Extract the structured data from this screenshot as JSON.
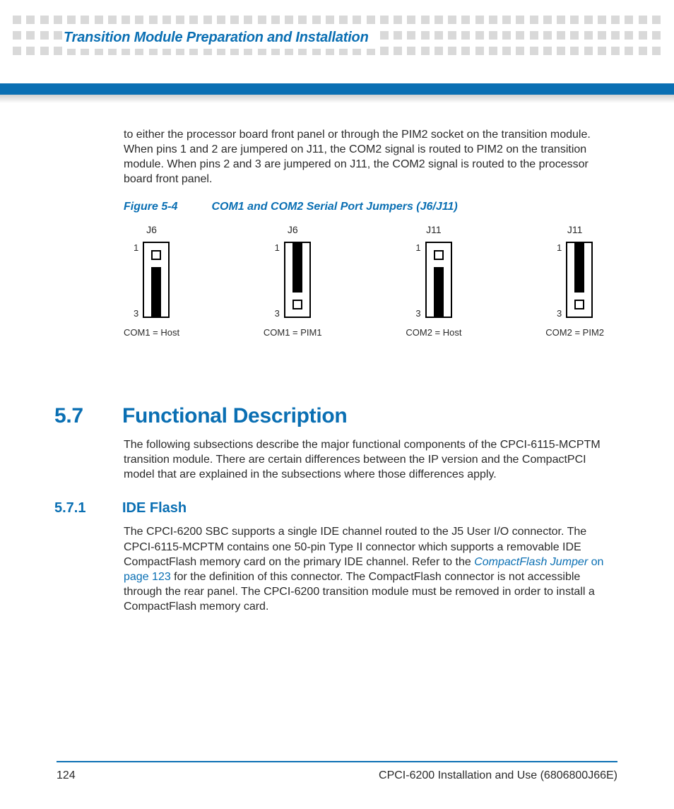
{
  "header": {
    "chapter_title": "Transition Module Preparation and Installation"
  },
  "paragraphs": {
    "p1": "to either the processor board front panel or through the PIM2 socket on the transition module. When pins 1 and 2 are jumpered on J11, the COM2 signal is routed to PIM2 on the transition module. When pins 2 and 3 are jumpered on J11, the COM2 signal is routed to the processor board front panel."
  },
  "figure": {
    "num": "Figure 5-4",
    "title": "COM1 and COM2 Serial Port Jumpers (J6/J11)",
    "jumpers": [
      {
        "name": "J6",
        "pin_top": "1",
        "pin_bot": "3",
        "config": "bottom",
        "caption": "COM1 = Host"
      },
      {
        "name": "J6",
        "pin_top": "1",
        "pin_bot": "3",
        "config": "top",
        "caption": "COM1 = PIM1"
      },
      {
        "name": "J11",
        "pin_top": "1",
        "pin_bot": "3",
        "config": "bottom",
        "caption": "COM2 = Host"
      },
      {
        "name": "J11",
        "pin_top": "1",
        "pin_bot": "3",
        "config": "top",
        "caption": "COM2 = PIM2"
      }
    ]
  },
  "section57": {
    "num": "5.7",
    "title": "Functional Description",
    "p": "The following subsections describe the major functional components of the CPCI-6115-MCPTM transition module. There are certain differences between the IP version and the CompactPCI model that are explained in the subsections where those differences apply."
  },
  "section571": {
    "num": "5.7.1",
    "title": "IDE Flash",
    "p_pre": "The CPCI-6200 SBC supports a single IDE channel routed to the J5 User I/O connector. The CPCI-6115-MCPTM contains one 50-pin Type II connector which supports a removable IDE CompactFlash memory card on the primary IDE channel. Refer to the ",
    "link_text": "CompactFlash Jumper",
    "link_post": " on page 123",
    "p_post": " for the definition of this connector. The CompactFlash connector is not accessible through the rear panel. The CPCI-6200 transition module must be removed in order to install a CompactFlash memory card."
  },
  "footer": {
    "page": "124",
    "doc": "CPCI-6200 Installation and Use (6806800J66E)"
  }
}
